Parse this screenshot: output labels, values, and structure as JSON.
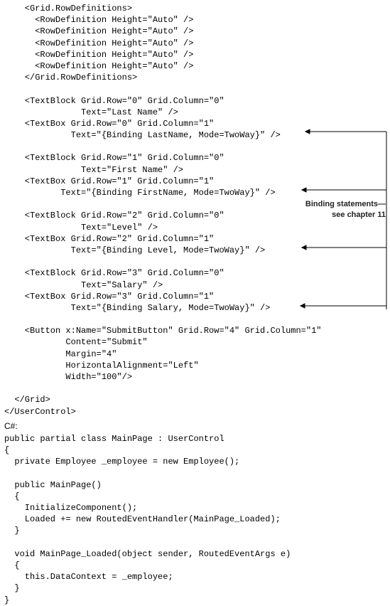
{
  "xaml": {
    "lines": [
      "    <Grid.RowDefinitions>",
      "      <RowDefinition Height=\"Auto\" />",
      "      <RowDefinition Height=\"Auto\" />",
      "      <RowDefinition Height=\"Auto\" />",
      "      <RowDefinition Height=\"Auto\" />",
      "      <RowDefinition Height=\"Auto\" />",
      "    </Grid.RowDefinitions>",
      "",
      "    <TextBlock Grid.Row=\"0\" Grid.Column=\"0\"",
      "               Text=\"Last Name\" />",
      "    <TextBox Grid.Row=\"0\" Grid.Column=\"1\"",
      "             Text=\"{Binding LastName, Mode=TwoWay}\" />",
      "",
      "    <TextBlock Grid.Row=\"1\" Grid.Column=\"0\"",
      "               Text=\"First Name\" />",
      "    <TextBox Grid.Row=\"1\" Grid.Column=\"1\"",
      "           Text=\"{Binding FirstName, Mode=TwoWay}\" />",
      "",
      "    <TextBlock Grid.Row=\"2\" Grid.Column=\"0\"",
      "               Text=\"Level\" />",
      "    <TextBox Grid.Row=\"2\" Grid.Column=\"1\"",
      "             Text=\"{Binding Level, Mode=TwoWay}\" />",
      "",
      "    <TextBlock Grid.Row=\"3\" Grid.Column=\"0\"",
      "               Text=\"Salary\" />",
      "    <TextBox Grid.Row=\"3\" Grid.Column=\"1\"",
      "             Text=\"{Binding Salary, Mode=TwoWay}\" />",
      "",
      "    <Button x:Name=\"SubmitButton\" Grid.Row=\"4\" Grid.Column=\"1\"",
      "            Content=\"Submit\"",
      "            Margin=\"4\"",
      "            HorizontalAlignment=\"Left\"",
      "            Width=\"100\"/>",
      "",
      "  </Grid>",
      "</UserControl>"
    ]
  },
  "csharp_label": "C#:",
  "csharp": {
    "lines": [
      "public partial class MainPage : UserControl",
      "{",
      "  private Employee _employee = new Employee();",
      "",
      "  public MainPage()",
      "  {",
      "    InitializeComponent();",
      "    Loaded += new RoutedEventHandler(MainPage_Loaded);",
      "  }",
      "",
      "  void MainPage_Loaded(object sender, RoutedEventArgs e)",
      "  {",
      "    this.DataContext = _employee;",
      "  }",
      "}"
    ]
  },
  "annotation": {
    "line1": "Binding statements",
    "line2": "see chapter 11"
  }
}
